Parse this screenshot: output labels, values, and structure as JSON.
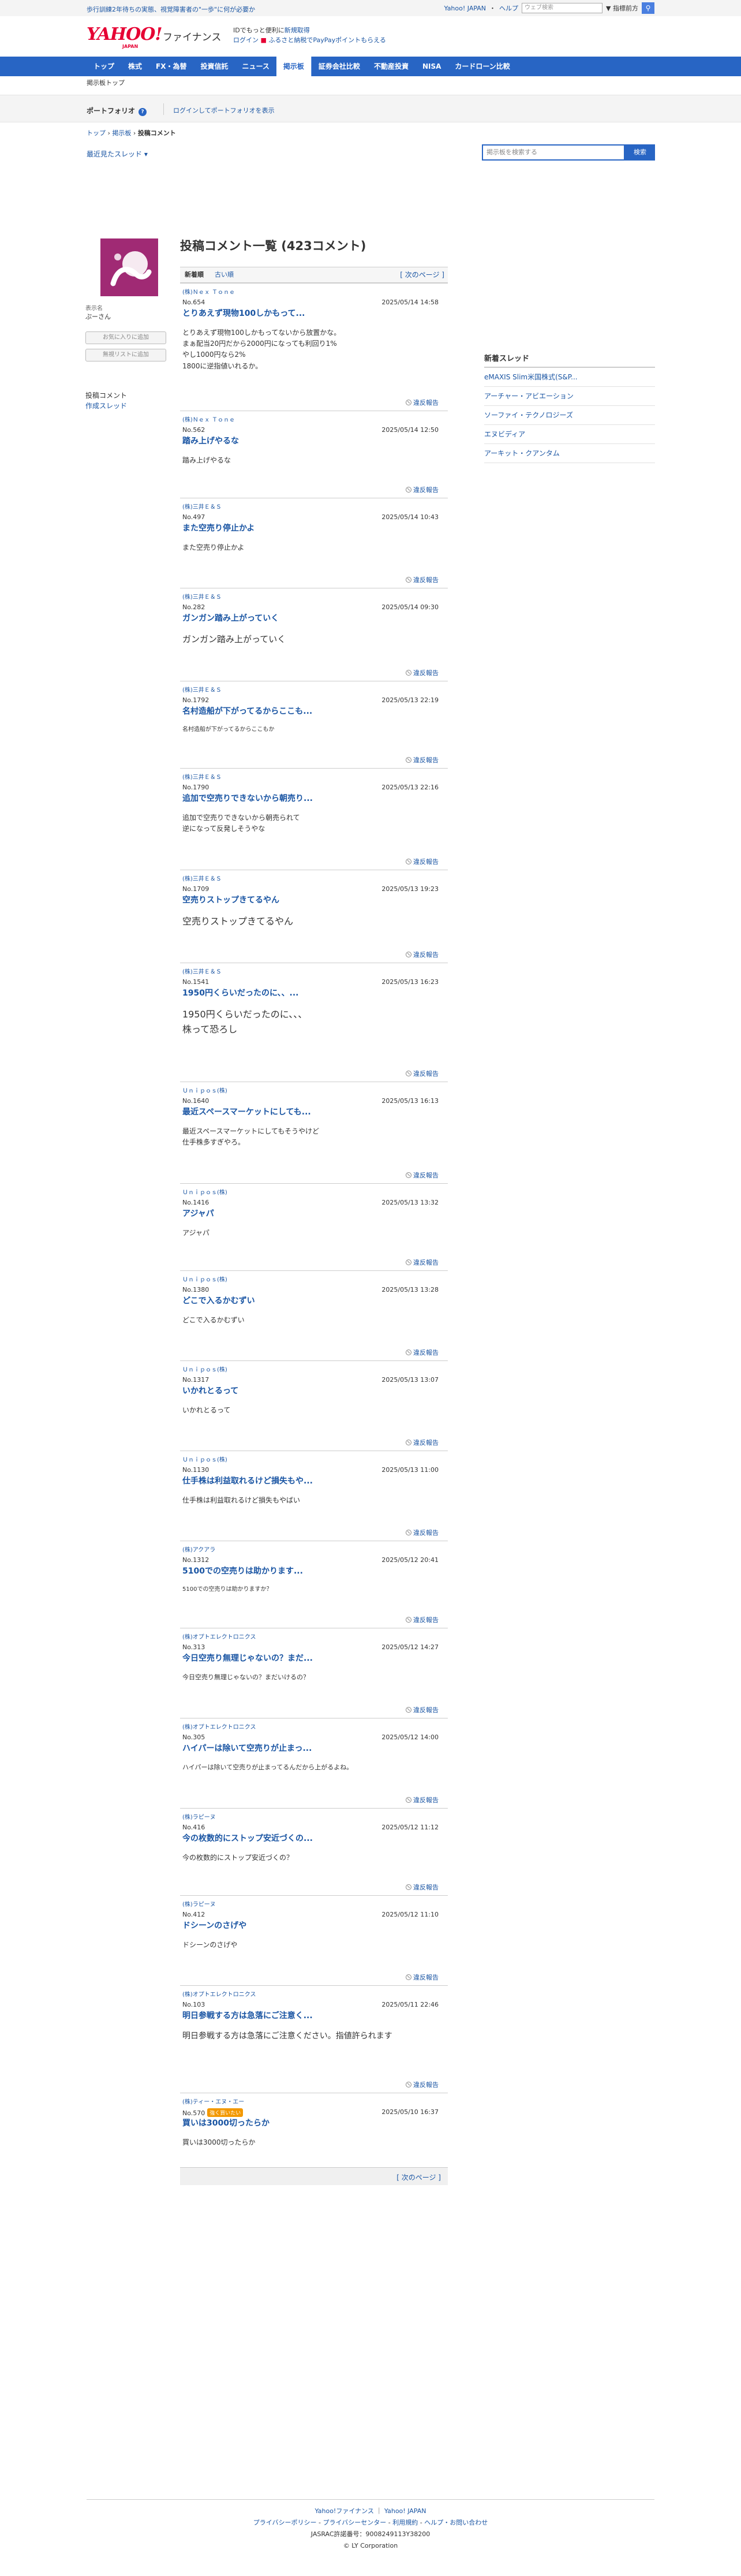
{
  "top": {
    "notice": "歩行訓練2年待ちの実態、視覚障害者の\"一歩\"に何が必要か",
    "links": [
      "Yahoo! JAPAN",
      "ヘルプ"
    ],
    "search_placeholder": "ウェブ検索",
    "search_scope": "▼ 指標前方"
  },
  "header": {
    "logo": "YAHOO!",
    "logo_sub": "JAPAN",
    "service": "ファイナンス",
    "promo1_a": "IDでもっと便利に",
    "promo1_b": "新規取得",
    "promo2_a": "ログイン",
    "promo2_b": "ふるさと納税でPayPayポイントもらえる"
  },
  "nav": [
    "トップ",
    "株式",
    "FX・為替",
    "投資信託",
    "ニュース",
    "掲示板",
    "証券会社比較",
    "不動産投資",
    "NISA",
    "カードローン比較"
  ],
  "nav_active_index": 5,
  "board_top": "掲示板トップ",
  "portfolio": {
    "label": "ポートフォリオ",
    "link": "ログインしてポートフォリオを表示"
  },
  "breadcrumb": [
    "トップ",
    "掲示板",
    "投稿コメント"
  ],
  "recent_threads": "最近見たスレッド",
  "board_search": {
    "placeholder": "掲示板を検索する",
    "button": "検索"
  },
  "user": {
    "display_label": "表示名",
    "display_name": "ぷーさん",
    "follow_btn": "お気に入りに追加",
    "ignore_btn": "無視リストに追加",
    "menu": [
      "投稿コメント",
      "作成スレッド"
    ]
  },
  "main": {
    "title": "投稿コメント一覧 (423コメント)",
    "tab_new": "新着順",
    "tab_old": "古い順",
    "next": "[ 次のページ ]",
    "report": "違反報告"
  },
  "comments": [
    {
      "user": "(株)Ｎｅｘ Ｔｏｎｅ",
      "no": "No.654",
      "date": "2025/05/14 14:58",
      "title": "とりあえず現物100しかもって...",
      "body": "とりあえず現物100しかもってないから放置かな。\nまぁ配当20円だから2000円になっても利回り1%\nやし1000円なら2%\n1800に逆指値いれるか。",
      "size": 12
    },
    {
      "user": "(株)Ｎｅｘ Ｔｏｎｅ",
      "no": "No.562",
      "date": "2025/05/14 12:50",
      "title": "踏み上げやるな",
      "body": "踏み上げやるな",
      "size": 12
    },
    {
      "user": "(株)三井Ｅ＆Ｓ",
      "no": "No.497",
      "date": "2025/05/14 10:43",
      "title": "また空売り停止かよ",
      "body": "また空売り停止かよ",
      "size": 12
    },
    {
      "user": "(株)三井Ｅ＆Ｓ",
      "no": "No.282",
      "date": "2025/05/14 09:30",
      "title": "ガンガン踏み上がっていく",
      "body": "ガンガン踏み上がっていく",
      "size": 15
    },
    {
      "user": "(株)三井Ｅ＆Ｓ",
      "no": "No.1792",
      "date": "2025/05/13 22:19",
      "title": "名村造船が下がってるからここも...",
      "body": "名村造船が下がってるからここもか",
      "size": 10
    },
    {
      "user": "(株)三井Ｅ＆Ｓ",
      "no": "No.1790",
      "date": "2025/05/13 22:16",
      "title": "追加で空売りできないから朝売り...",
      "body": "追加で空売りできないから朝売られて\n逆になって反発しそうやな",
      "size": 12
    },
    {
      "user": "(株)三井Ｅ＆Ｓ",
      "no": "No.1709",
      "date": "2025/05/13 19:23",
      "title": "空売りストップきてるやん",
      "body": "空売りストップきてるやん",
      "size": 16
    },
    {
      "user": "(株)三井Ｅ＆Ｓ",
      "no": "No.1541",
      "date": "2025/05/13 16:23",
      "title": "1950円くらいだったのに、、...",
      "body": "1950円くらいだったのに、、、\n株って恐ろし",
      "size": 16
    },
    {
      "user": "Ｕｎｉｐｏｓ(株)",
      "no": "No.1640",
      "date": "2025/05/13 16:13",
      "title": "最近スペースマーケットにしても...",
      "body": "最近スペースマーケットにしてもそうやけど\n仕手株多すぎやろ。",
      "size": 12
    },
    {
      "user": "Ｕｎｉｐｏｓ(株)",
      "no": "No.1416",
      "date": "2025/05/13 13:32",
      "title": "アジャパ",
      "body": "アジャパ",
      "size": 12
    },
    {
      "user": "Ｕｎｉｐｏｓ(株)",
      "no": "No.1380",
      "date": "2025/05/13 13:28",
      "title": "どこで入るかむずい",
      "body": "どこで入るかむずい",
      "size": 12
    },
    {
      "user": "Ｕｎｉｐｏｓ(株)",
      "no": "No.1317",
      "date": "2025/05/13 13:07",
      "title": "いかれとるって",
      "body": "いかれとるって",
      "size": 12
    },
    {
      "user": "Ｕｎｉｐｏｓ(株)",
      "no": "No.1130",
      "date": "2025/05/13 11:00",
      "title": "仕手株は利益取れるけど損失もや...",
      "body": "仕手株は利益取れるけど損失もやばい",
      "size": 12
    },
    {
      "user": "(株)アクアラ",
      "no": "No.1312",
      "date": "2025/05/12 20:41",
      "title": "5100での空売りは助かります...",
      "body": "5100での空売りは助かりますか？",
      "size": 10
    },
    {
      "user": "(株)オプトエレクトロニクス",
      "no": "No.313",
      "date": "2025/05/12 14:27",
      "title": "今日空売り無理じゃないの？まだ...",
      "body": "今日空売り無理じゃないの？まだいけるの？",
      "size": 11
    },
    {
      "user": "(株)オプトエレクトロニクス",
      "no": "No.305",
      "date": "2025/05/12 14:00",
      "title": "ハイパーは除いて空売りが止まっ...",
      "body": "ハイパーは除いて空売りが止まってるんだから上がるよね。",
      "size": 11
    },
    {
      "user": "(株)ラピーヌ",
      "no": "No.416",
      "date": "2025/05/12 11:12",
      "title": "今の枚数的にストップ安近づくの...",
      "body": "今の枚数的にストップ安近づくの？",
      "size": 12
    },
    {
      "user": "(株)ラピーヌ",
      "no": "No.412",
      "date": "2025/05/12 11:10",
      "title": "ドシーンのさげや",
      "body": "ドシーンのさげや",
      "size": 12
    },
    {
      "user": "(株)オプトエレクトロニクス",
      "no": "No.103",
      "date": "2025/05/11 22:46",
      "title": "明日参戦する方は急落にご注意く...",
      "body": "明日参戦する方は急落にご注意ください。指値許られます",
      "size": 14
    },
    {
      "user": "(株)ティー・エヌ・エー",
      "no": "No.570",
      "badge": "強く買いたい",
      "date": "2025/05/10 16:37",
      "title": "買いは3000切ったらか",
      "body": "買いは3000切ったらか",
      "size": 12
    }
  ],
  "right": {
    "title": "新着スレッド",
    "threads": [
      "eMAXIS Slim米国株式(S&P...",
      "アーチャー・アビエーション",
      "ソーファイ・テクノロジーズ",
      "エヌビディア",
      "アーキット・クアンタム"
    ]
  },
  "footer": {
    "line1": [
      "Yahoo!ファイナンス",
      "Yahoo! JAPAN"
    ],
    "line2": [
      "プライバシーポリシー",
      "プライバシーセンター",
      "利用規約",
      "ヘルプ・お問い合わせ"
    ],
    "line3": "JASRAC許諾番号：9008249113Y38200",
    "line4": "© LY Corporation"
  },
  "colors": {
    "accent": "#2865c4",
    "link": "#1a55a3",
    "brand_red": "#e60033",
    "avatar": "#a02a74"
  }
}
